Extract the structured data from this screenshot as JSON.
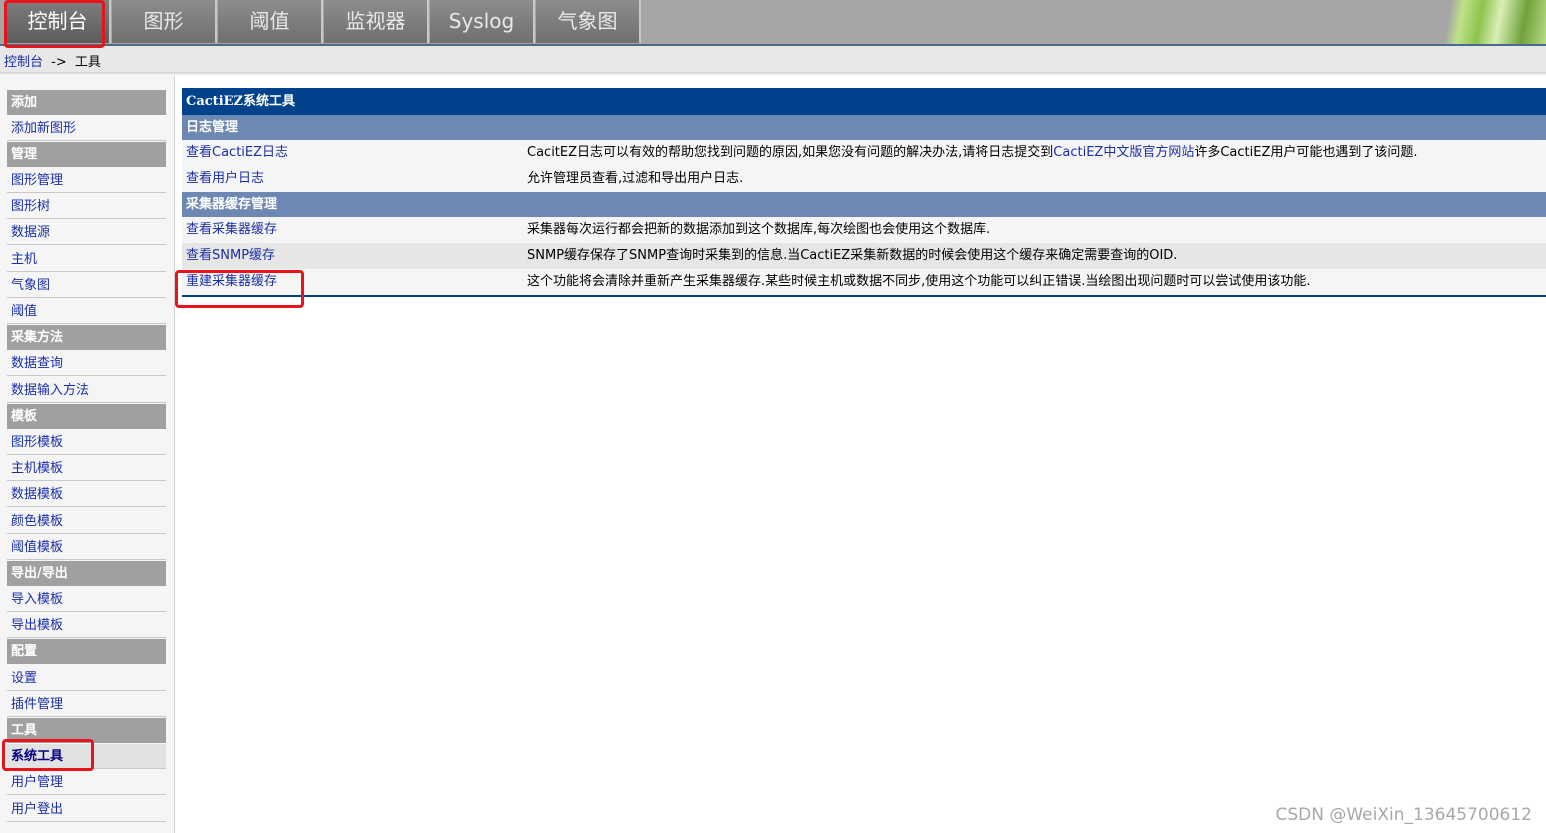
{
  "tabs": [
    {
      "label": "控制台",
      "active": true
    },
    {
      "label": "图形",
      "active": false
    },
    {
      "label": "阈值",
      "active": false
    },
    {
      "label": "监视器",
      "active": false
    },
    {
      "label": "Syslog",
      "active": false
    },
    {
      "label": "气象图",
      "active": false
    }
  ],
  "breadcrumb": {
    "home": "控制台",
    "sep": "->",
    "current": "工具"
  },
  "sidebar": {
    "add": {
      "header": "添加",
      "items": [
        "添加新图形"
      ]
    },
    "manage": {
      "header": "管理",
      "items": [
        "图形管理",
        "图形树",
        "数据源",
        "主机",
        "气象图",
        "阈值"
      ]
    },
    "collect": {
      "header": "采集方法",
      "items": [
        "数据查询",
        "数据输入方法"
      ]
    },
    "templates": {
      "header": "模板",
      "items": [
        "图形模板",
        "主机模板",
        "数据模板",
        "颜色模板",
        "阈值模板"
      ]
    },
    "io": {
      "header": "导出/导出",
      "items": [
        "导入模板",
        "导出模板"
      ]
    },
    "config": {
      "header": "配置",
      "items": [
        "设置",
        "插件管理"
      ]
    },
    "tools": {
      "header": "工具",
      "items": [
        "系统工具",
        "用户管理",
        "用户登出"
      ],
      "selected": "系统工具"
    }
  },
  "main": {
    "title": "CactiEZ系统工具",
    "sections": [
      {
        "label": "日志管理",
        "rows": [
          {
            "link": "查看CactiEZ日志",
            "desc_pre": "CacitEZ日志可以有效的帮助您找到问题的原因,如果您没有问题的解决办法,请将日志提交到",
            "desc_link": "CactiEZ中文版官方网站",
            "desc_post": "许多CactiEZ用户可能也遇到了该问题."
          },
          {
            "link": "查看用户日志",
            "desc": "允许管理员查看,过滤和导出用户日志."
          }
        ]
      },
      {
        "label": "采集器缓存管理",
        "rows": [
          {
            "link": "查看采集器缓存",
            "desc": "采集器每次运行都会把新的数据添加到这个数据库,每次绘图也会使用这个数据库."
          },
          {
            "link": "查看SNMP缓存",
            "desc": "SNMP缓存保存了SNMP查询时采集到的信息.当CactiEZ采集新数据的时候会使用这个缓存来确定需要查询的OID."
          },
          {
            "link": "重建采集器缓存",
            "desc": "这个功能将会清除并重新产生采集器缓存.某些时候主机或数据不同步,使用这个功能可以纠正错误.当绘图出现问题时可以尝试使用该功能."
          }
        ]
      }
    ]
  },
  "watermark": "CSDN @WeiXin_13645700612",
  "colors": {
    "title_bar": "#00438c",
    "section_bar": "#6d89b3",
    "link": "#1a2fa8",
    "highlight": "#e8141b"
  }
}
